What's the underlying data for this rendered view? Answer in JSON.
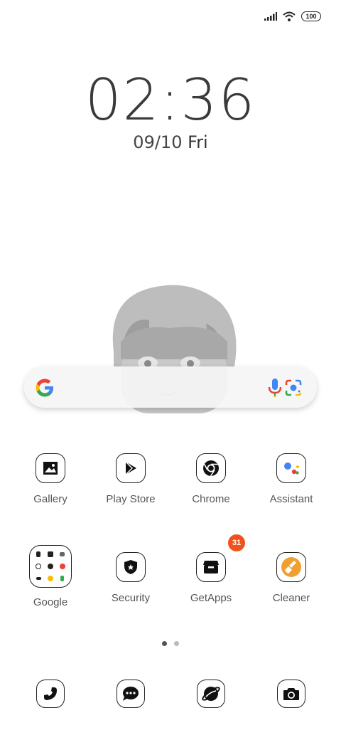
{
  "status": {
    "battery": "100"
  },
  "clock": {
    "time": "02:36",
    "date": "09/10",
    "day": "Fri"
  },
  "apps_row1": [
    {
      "label": "Gallery",
      "icon": "gallery-icon"
    },
    {
      "label": "Play Store",
      "icon": "play-store-icon"
    },
    {
      "label": "Chrome",
      "icon": "chrome-icon"
    },
    {
      "label": "Assistant",
      "icon": "assistant-icon"
    }
  ],
  "apps_row2": [
    {
      "label": "Google",
      "icon": "google-folder"
    },
    {
      "label": "Security",
      "icon": "security-icon"
    },
    {
      "label": "GetApps",
      "icon": "getapps-icon",
      "badge": "31"
    },
    {
      "label": "Cleaner",
      "icon": "cleaner-icon"
    }
  ],
  "dock": [
    {
      "icon": "phone-icon"
    },
    {
      "icon": "messages-icon"
    },
    {
      "icon": "browser-icon"
    },
    {
      "icon": "camera-icon"
    }
  ],
  "colors": {
    "badge": "#f0521e",
    "cleaner": "#f0a030"
  }
}
